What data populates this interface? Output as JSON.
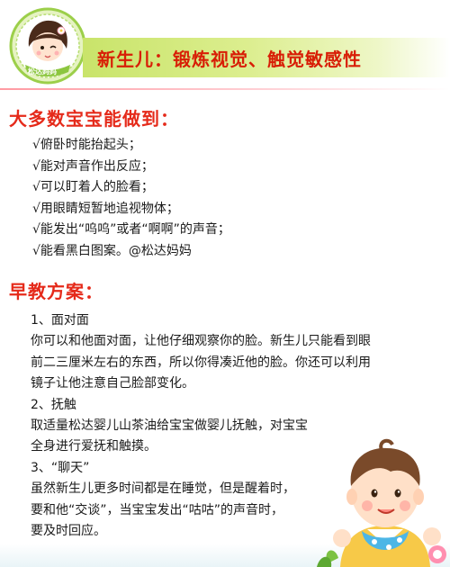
{
  "header": {
    "title": "新生儿：锻炼视觉、触觉敏感性",
    "logo_text": "松达妈妈",
    "colors": {
      "banner": "#c9e46a",
      "title": "#d81e06",
      "section": "#e52a1a"
    }
  },
  "abilities": {
    "heading": "大多数宝宝能做到：",
    "items": [
      "√俯卧时能抬起头；",
      "√能对声音作出反应；",
      "√可以盯着人的脸看；",
      "√用眼睛短暂地追视物体；",
      "√能发出“呜呜”或者“啊啊”的声音；",
      "√能看黑白图案。@松达妈妈"
    ]
  },
  "plan": {
    "heading": "早教方案：",
    "lines": [
      "1、面对面",
      "你可以和他面对面，让他仔细观察你的脸。新生儿只能看到眼",
      "前二三厘米左右的东西，所以你得凑近他的脸。你还可以利用",
      "镜子让他注意自己脸部变化。",
      "2、抚触",
      "取适量松达婴儿山茶油给宝宝做婴儿抚触，对宝宝",
      "全身进行爱抚和触摸。",
      "3、“聊天”",
      "虽然新生儿更多时间都是在睡觉，但是醒着时，",
      "要和他“交谈”，当宝宝发出“咕咕”的声音时，",
      "要及时回应。"
    ]
  },
  "icons": {
    "logo": "mother-avatar-icon",
    "decoration": "baby-illustration-icon"
  }
}
